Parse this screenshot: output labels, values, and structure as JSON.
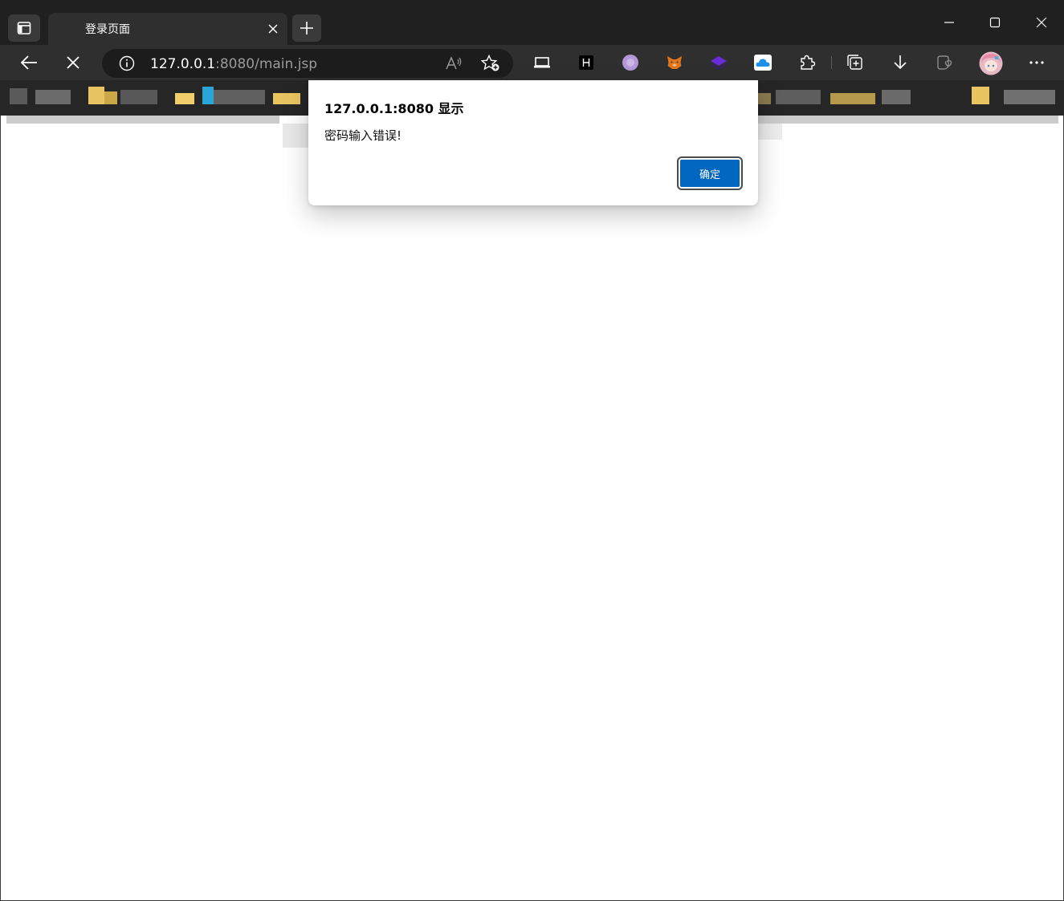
{
  "browser": {
    "tab": {
      "title": "登录页面"
    },
    "address": {
      "host": "127.0.0.1",
      "rest": ":8080/main.jsp"
    }
  },
  "dialog": {
    "title": "127.0.0.1:8080 显示",
    "message": "密码输入错误!",
    "ok_label": "确定"
  },
  "icons": {
    "tab_actions": "tab-actions-icon",
    "tab_close": "close-icon",
    "new_tab": "plus-icon",
    "minimize": "minimize-icon",
    "maximize": "maximize-icon",
    "close_window": "close-icon",
    "back": "arrow-left-icon",
    "stop": "stop-icon",
    "site_info": "info-icon",
    "read_aloud": "read-aloud-icon",
    "favorite": "star-add-icon",
    "extensions": "puzzle-icon",
    "collections": "collections-icon",
    "downloads": "download-icon",
    "browser_essentials": "heart-shield-icon",
    "profile": "avatar",
    "more": "more-icon"
  },
  "colors": {
    "tabstrip": "#202020",
    "toolbar": "#2f2f2f",
    "accent": "#0067c0"
  }
}
